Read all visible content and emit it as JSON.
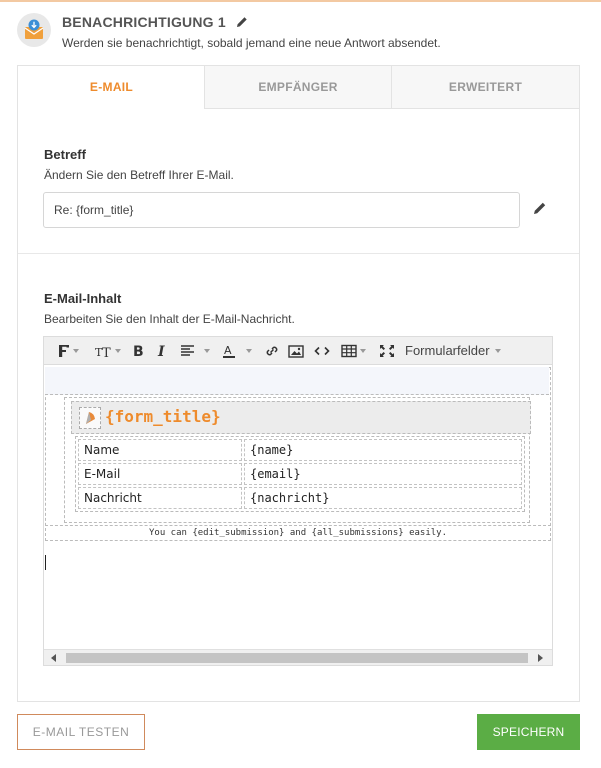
{
  "header": {
    "title": "BENACHRICHTIGUNG 1",
    "description": "Werden sie benachrichtigt, sobald jemand eine neue Antwort absendet."
  },
  "tabs": [
    {
      "label": "E-MAIL",
      "active": true
    },
    {
      "label": "EMPFÄNGER",
      "active": false
    },
    {
      "label": "ERWEITERT",
      "active": false
    }
  ],
  "subject": {
    "title": "Betreff",
    "description": "Ändern Sie den Betreff Ihrer E-Mail.",
    "value": "Re: {form_title}"
  },
  "content": {
    "title": "E-Mail-Inhalt",
    "description": "Bearbeiten Sie den Inhalt der E-Mail-Nachricht."
  },
  "toolbar": {
    "form_fields_label": "Formularfelder"
  },
  "email_body": {
    "form_title": "{form_title}",
    "rows": [
      {
        "label": "Name",
        "value": "{name}"
      },
      {
        "label": "E-Mail",
        "value": "{email}"
      },
      {
        "label": "Nachricht",
        "value": "{nachricht}"
      }
    ],
    "note": "You can {edit_submission} and {all_submissions} easily."
  },
  "buttons": {
    "test_label": "E-MAIL TESTEN",
    "save_label": "SPEICHERN"
  },
  "colors": {
    "accent": "#ee8b2c",
    "save": "#5bad45"
  }
}
